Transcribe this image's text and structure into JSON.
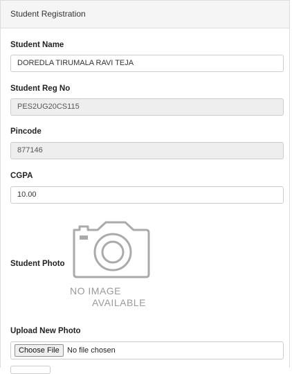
{
  "panel": {
    "title": "Student Registration"
  },
  "form": {
    "student_name": {
      "label": "Student Name",
      "value": "DOREDLA TIRUMALA RAVI TEJA"
    },
    "reg_no": {
      "label": "Student Reg No",
      "value": "PES2UG20CS115"
    },
    "pincode": {
      "label": "Pincode",
      "value": "877146"
    },
    "cgpa": {
      "label": "CGPA",
      "value": "10.00"
    },
    "photo": {
      "label": "Student Photo",
      "placeholder_line1": "NO IMAGE",
      "placeholder_line2": "AVAILABLE",
      "icon": "camera-icon"
    },
    "upload": {
      "label": "Upload New Photo",
      "button_label": "Choose File",
      "status": "No file chosen"
    }
  },
  "colors": {
    "heading_bg": "#f5f5f5",
    "readonly_bg": "#eeeeee",
    "border": "#cccccc",
    "placeholder_gray": "#9a9a9a"
  }
}
